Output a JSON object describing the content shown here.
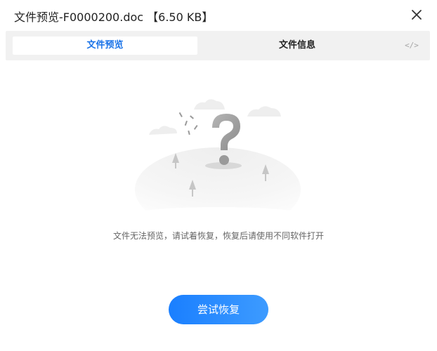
{
  "dialog": {
    "title": "文件预览-F0000200.doc 【6.50 KB】",
    "close_icon": "close-icon"
  },
  "tabs": [
    {
      "label": "文件预览",
      "active": true
    },
    {
      "label": "文件信息",
      "active": false
    },
    {
      "label": "</>",
      "active": false
    }
  ],
  "empty_state": {
    "illustration_icon": "question-mark-icon",
    "message": "文件无法预览，请试着恢复，恢复后请使用不同软件打开"
  },
  "actions": {
    "restore_label": "尝试恢复"
  },
  "colors": {
    "accent": "#1a73e8",
    "button_start": "#1a7fff",
    "button_end": "#3d9bff",
    "tabbar_bg": "#f1f1f1"
  }
}
